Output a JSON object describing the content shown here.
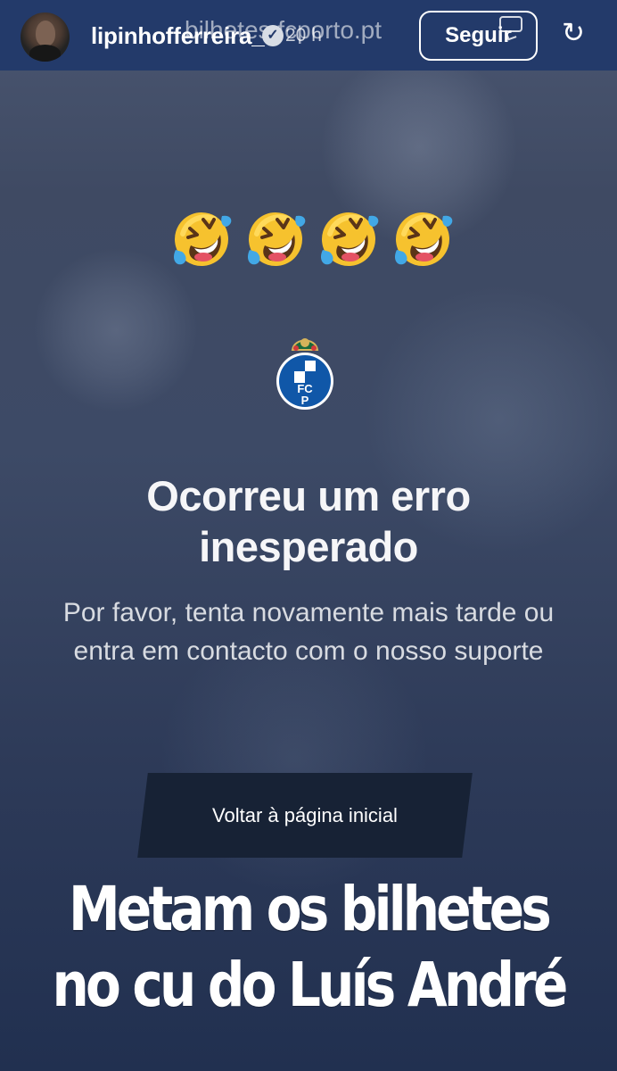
{
  "story_header": {
    "username": "lipinhofferreira_",
    "time": "20 h",
    "url_overlay": "bilhetes.fcporto.pt",
    "follow_label": "Seguir"
  },
  "icons": {
    "avatar": "profile-photo",
    "verified": "verified-badge-icon",
    "chat": "message-icon",
    "refresh": "refresh-icon",
    "emoji": "rolling-on-the-floor-laughing-emoji",
    "crest": "fc-porto-crest"
  },
  "reaction": {
    "emojis": [
      "🤣",
      "🤣",
      "🤣",
      "🤣"
    ]
  },
  "error_page": {
    "title": "Ocorreu um erro inesperado",
    "message": "Por favor, tenta novamente mais tarde ou entra em contacto com o nosso suporte",
    "button_label": "Voltar à página inicial",
    "crest_letters": {
      "top": "FC",
      "bottom": "P"
    }
  },
  "story_caption": "Metam os bilhetes no cu do Luís André",
  "colors": {
    "header_background": "#233a6a",
    "button_background": "#172235",
    "text_primary": "#ffffff",
    "text_secondary": "#d8dbe1",
    "emoji_yellow": "#f6c22e",
    "tear_blue": "#42a8e6",
    "crest_blue": "#1057a8"
  }
}
